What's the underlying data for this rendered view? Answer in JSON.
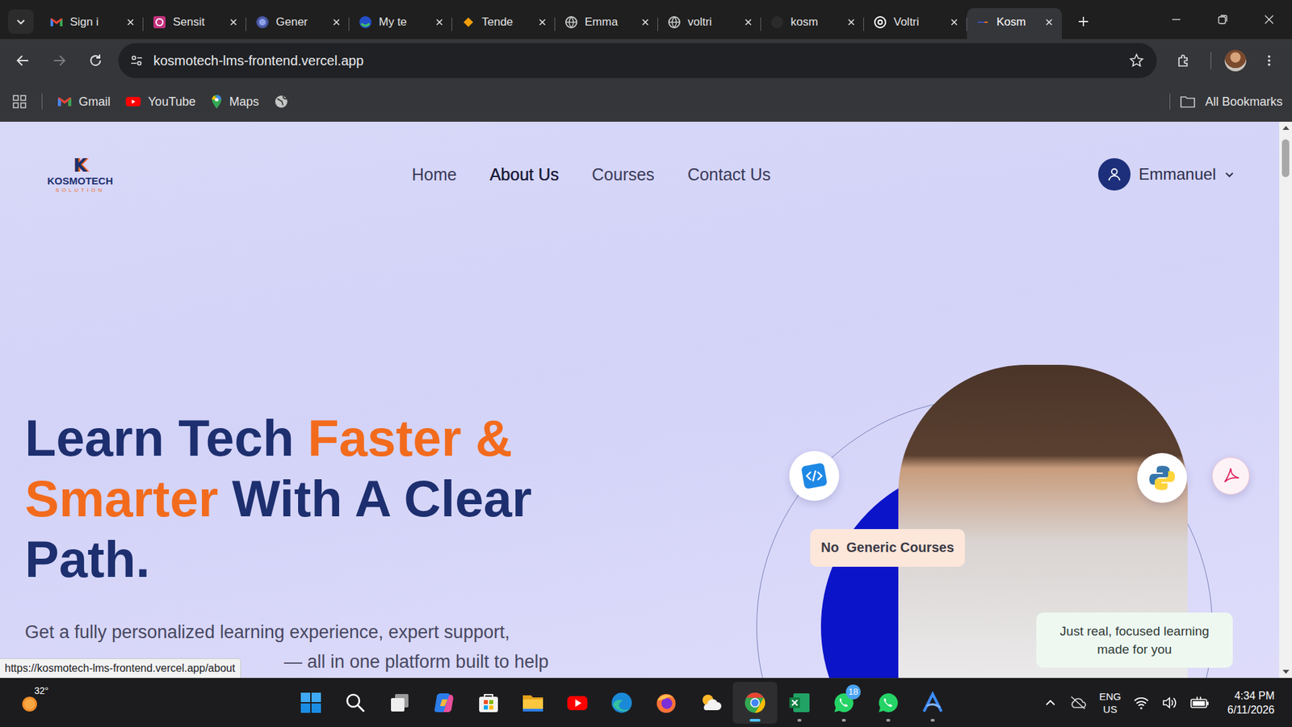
{
  "browser": {
    "tabs": [
      {
        "label": "Sign i",
        "kind": "gmail",
        "selected": false
      },
      {
        "label": "Sensit",
        "kind": "square",
        "selected": false
      },
      {
        "label": "Gener",
        "kind": "orb",
        "selected": false
      },
      {
        "label": "My te",
        "kind": "shield",
        "selected": false
      },
      {
        "label": "Tende",
        "kind": "diamond",
        "selected": false
      },
      {
        "label": "Emma",
        "kind": "globe",
        "selected": false
      },
      {
        "label": "voltri",
        "kind": "globe",
        "selected": false
      },
      {
        "label": "kosm",
        "kind": "dark",
        "selected": false
      },
      {
        "label": "Voltri",
        "kind": "knot",
        "selected": false
      },
      {
        "label": "Kosm",
        "kind": "logo",
        "selected": true
      }
    ],
    "toolbar": {
      "back_disabled": false,
      "forward_disabled": true,
      "url": "kosmotech-lms-frontend.vercel.app",
      "bookmarked": false
    },
    "bookmarks": [
      {
        "label": "Gmail",
        "kind": "gmail"
      },
      {
        "label": "YouTube",
        "kind": "youtube"
      },
      {
        "label": "Maps",
        "kind": "maps"
      }
    ],
    "all_bookmarks": "All Bookmarks",
    "status_url": "https://kosmotech-lms-frontend.vercel.app/about"
  },
  "site": {
    "logo": {
      "mark": "K",
      "name": "KOSMOTECH",
      "tagline": "SOLUTION"
    },
    "nav": [
      {
        "label": "Home",
        "selected": false
      },
      {
        "label": "About Us",
        "selected": true
      },
      {
        "label": "Courses",
        "selected": false
      },
      {
        "label": "Contact Us",
        "selected": false
      }
    ],
    "user": {
      "name": "Emmanuel"
    },
    "hero": {
      "title_lines": [
        [
          {
            "text": "Learn Tech",
            "color": "#1d2f6f"
          },
          {
            "text": "Faster &",
            "color": "#f26b1d"
          }
        ],
        [
          {
            "text": "Smarter",
            "color": "#f26b1d"
          },
          {
            "text": "With A Clear",
            "color": "#1d2f6f"
          }
        ],
        [
          {
            "text": "Path.",
            "color": "#1d2f6f"
          }
        ]
      ],
      "subtitle_lines": [
        "Get a fully personalized learning experience, expert support,",
        "— all in one platform built to help"
      ],
      "badges": [
        "No  Generic Courses",
        "Just real, focused learning made for you"
      ]
    }
  },
  "taskbar": {
    "weather": "32°",
    "apps": [
      {
        "kind": "start",
        "running": false,
        "active": false
      },
      {
        "kind": "search",
        "running": false,
        "active": false
      },
      {
        "kind": "taskview",
        "running": false,
        "active": false
      },
      {
        "kind": "copilot",
        "running": false,
        "active": false
      },
      {
        "kind": "store",
        "running": false,
        "active": false
      },
      {
        "kind": "explorer",
        "running": false,
        "active": false
      },
      {
        "kind": "youtube",
        "running": false,
        "active": false
      },
      {
        "kind": "edge",
        "running": false,
        "active": false
      },
      {
        "kind": "firefox",
        "running": false,
        "active": false
      },
      {
        "kind": "weather",
        "running": false,
        "active": false
      },
      {
        "kind": "chrome",
        "running": true,
        "active": true
      },
      {
        "kind": "excel",
        "running": true,
        "active": false
      },
      {
        "kind": "whatsapp",
        "running": true,
        "active": false,
        "badge": "18"
      },
      {
        "kind": "whatsapp",
        "running": true,
        "active": false
      },
      {
        "kind": "arc",
        "running": true,
        "active": false
      }
    ],
    "lang": "ENG",
    "region": "US",
    "time": "4:34 PM",
    "date": "6/11/2026"
  }
}
